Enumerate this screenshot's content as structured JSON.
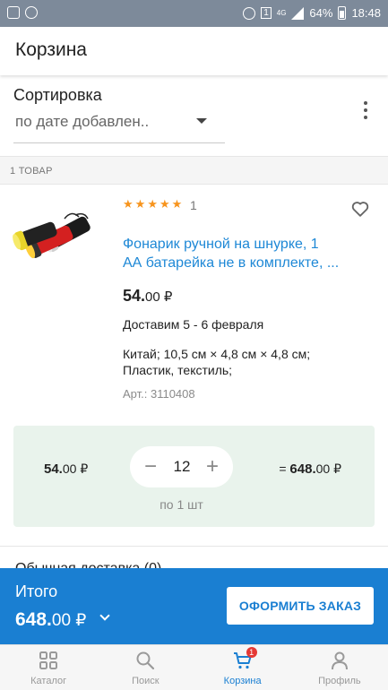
{
  "status_bar": {
    "network": "4G",
    "battery": "64%",
    "time": "18:48",
    "sim": "1"
  },
  "appbar": {
    "title": "Корзина"
  },
  "sort": {
    "label": "Сортировка",
    "value": "по дате добавлен.."
  },
  "section": {
    "count_label": "1 ТОВАР"
  },
  "product": {
    "rating_count": "1",
    "stars": 5,
    "title_line1": "Фонарик ручной на шнурке, 1",
    "title_line2": "АА батарейка не в комплекте, ...",
    "price_main": "54.",
    "price_cents": "00 ₽",
    "delivery": "Доставим 5 - 6 февраля",
    "specs_line1": "Китай; 10,5 см × 4,8 см × 4,8 см;",
    "specs_line2": "Пластик, текстиль;",
    "article": "Арт.: 3110408"
  },
  "quantity_panel": {
    "unit_price_main": "54.",
    "unit_price_cents": "00 ₽",
    "minus": "−",
    "quantity": "12",
    "plus": "+",
    "per_unit": "по 1 шт",
    "total_prefix": "= ",
    "total_main": "648.",
    "total_cents": "00 ₽"
  },
  "next_section_peek": "Обычная доставка (0)",
  "checkout": {
    "label": "Итого",
    "total_main": "648.",
    "total_cents": "00 ₽",
    "button": "ОФОРМИТЬ ЗАКАЗ"
  },
  "bottom_nav": {
    "items": [
      {
        "label": "Каталог",
        "icon": "grid-icon"
      },
      {
        "label": "Поиск",
        "icon": "search-icon"
      },
      {
        "label": "Корзина",
        "icon": "cart-icon",
        "badge": "1",
        "active": true
      },
      {
        "label": "Профиль",
        "icon": "person-icon"
      }
    ]
  },
  "colors": {
    "accent": "#1a7fd2",
    "star": "#f7941d",
    "panel": "#e9f3ec",
    "badge": "#e53935"
  }
}
